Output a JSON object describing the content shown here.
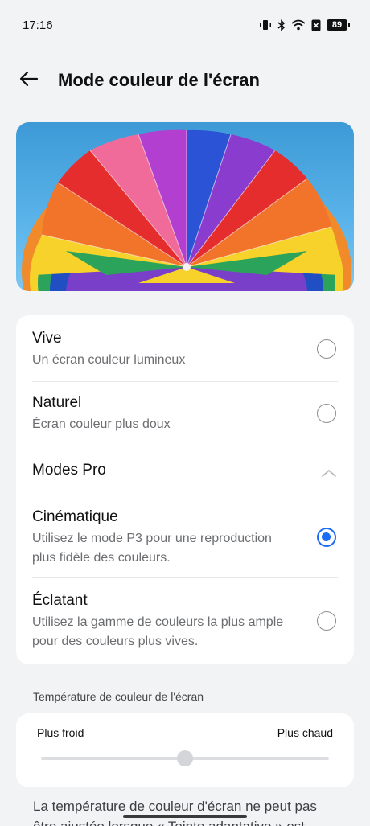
{
  "status_bar": {
    "time": "17:16",
    "battery": "89",
    "icons": [
      "vibrate-icon",
      "bluetooth-icon",
      "wifi-icon",
      "sim-off-icon",
      "battery-icon"
    ]
  },
  "header": {
    "title": "Mode couleur de l'écran",
    "back_icon": "arrow-left-icon"
  },
  "options": {
    "vive": {
      "title": "Vive",
      "subtitle": "Un écran couleur lumineux",
      "selected": false
    },
    "naturel": {
      "title": "Naturel",
      "subtitle": "Écran couleur plus doux",
      "selected": false
    },
    "pro": {
      "title": "Modes Pro",
      "expanded": true
    },
    "cinematique": {
      "title": "Cinématique",
      "subtitle_line1": "Utilisez le mode P3 pour une reproduction",
      "subtitle_line2": "plus fidèle des couleurs.",
      "selected": true
    },
    "eclatant": {
      "title": "Éclatant",
      "subtitle_line1": "Utilisez la gamme de couleurs la plus ample",
      "subtitle_line2": "pour des couleurs plus vives.",
      "selected": false
    }
  },
  "temperature": {
    "section_label": "Température de couleur de l'écran",
    "cold_label": "Plus froid",
    "warm_label": "Plus chaud",
    "level": 0.5
  },
  "note": {
    "line1": "La température de couleur d'écran ne peut pas",
    "line2": "être ajustée lorsque « Teinte adaptative » est"
  },
  "colors": {
    "accent": "#1a6cf2",
    "background": "#f2f3f5",
    "card": "#ffffff"
  }
}
